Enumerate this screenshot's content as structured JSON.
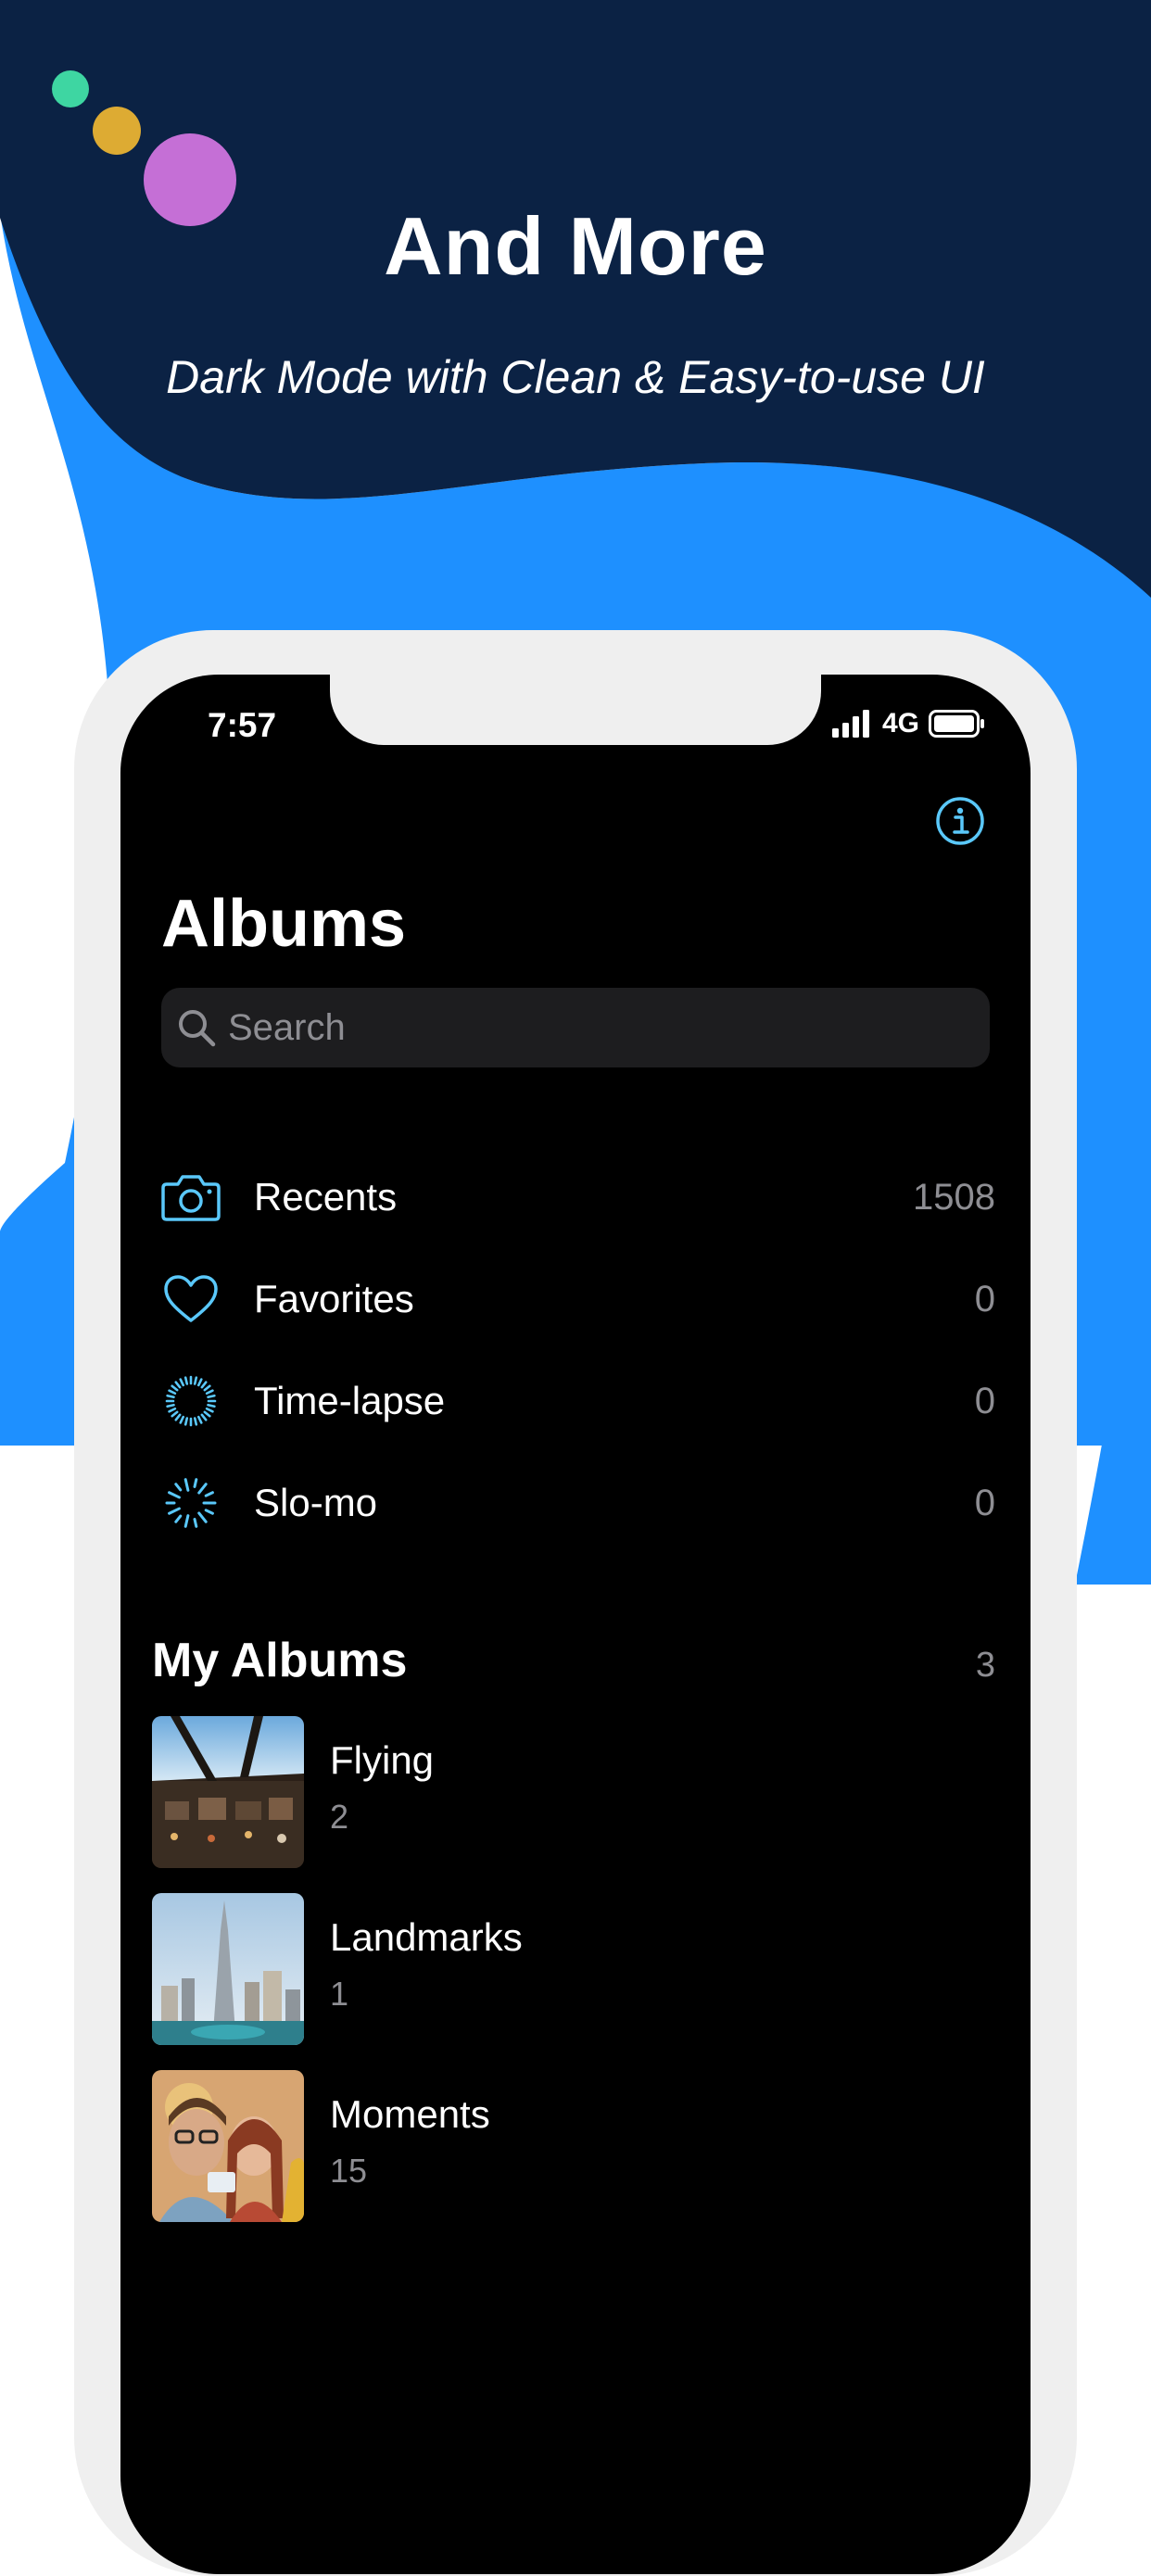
{
  "promo": {
    "headline": "And More",
    "subline": "Dark Mode with Clean & Easy-to-use UI",
    "colors": {
      "navy": "#0b2244",
      "blue": "#1e90ff",
      "dot_green": "#3ed6a2",
      "dot_yellow": "#ddab33",
      "dot_purple": "#c56fd6"
    }
  },
  "status_bar": {
    "time": "7:57",
    "network": "4G"
  },
  "header": {
    "title": "Albums",
    "info_icon": "info-icon"
  },
  "search": {
    "placeholder": "Search"
  },
  "media_types": [
    {
      "label": "Recents",
      "count": "1508",
      "icon": "camera-icon"
    },
    {
      "label": "Favorites",
      "count": "0",
      "icon": "heart-icon"
    },
    {
      "label": "Time-lapse",
      "count": "0",
      "icon": "timelapse-icon"
    },
    {
      "label": "Slo-mo",
      "count": "0",
      "icon": "slomo-icon"
    }
  ],
  "my_albums": {
    "title": "My Albums",
    "count": "3",
    "items": [
      {
        "name": "Flying",
        "count": "2"
      },
      {
        "name": "Landmarks",
        "count": "1"
      },
      {
        "name": "Moments",
        "count": "15"
      }
    ]
  },
  "accent_color": "#5ac8fa"
}
